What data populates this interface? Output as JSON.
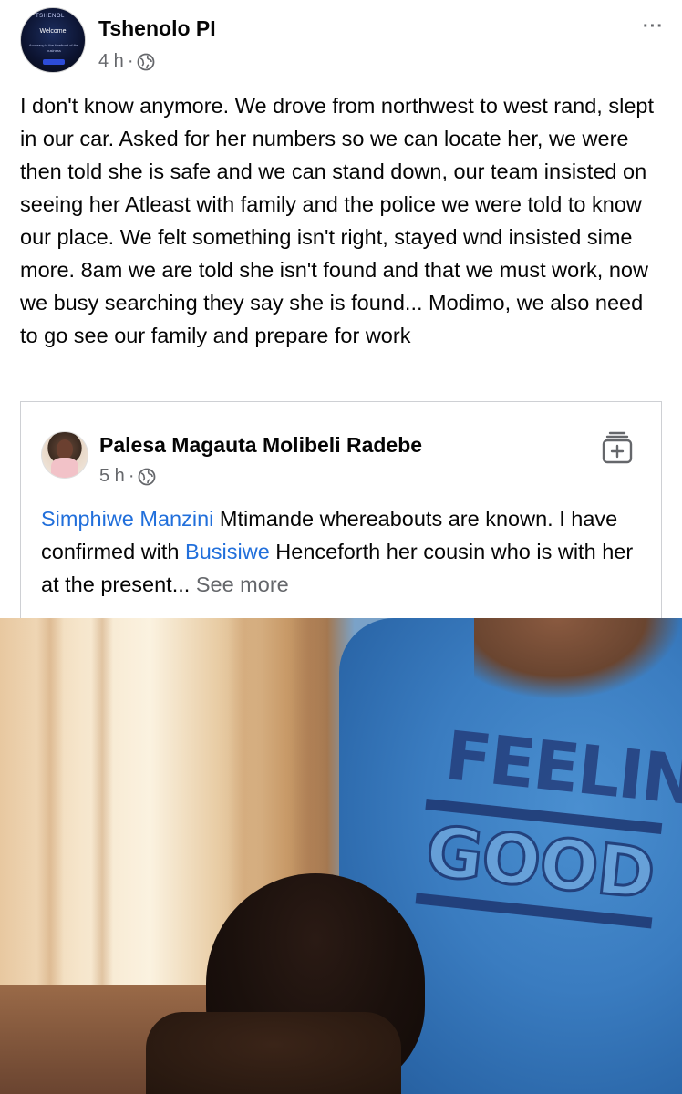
{
  "post": {
    "author": "Tshenolo PI",
    "time": "4 h",
    "separator": "·",
    "privacy_icon": "globe-icon",
    "more_icon": "···",
    "avatar_text": {
      "brand": "TSHENOL",
      "welcome": "Welcome",
      "tagline": "Accuracy is the forefront of the business"
    },
    "text": "I don't know anymore. We drove from northwest to west rand, slept in our car. Asked for her numbers so we can locate her, we were then told she is safe and we can stand down, our team insisted on seeing her Atleast with family and the police we were told to know our place. We felt something isn't right, stayed wnd insisted sime more. 8am we are told she isn't found and that we must work, now we busy searching they say she is found... Modimo, we also need to go see our family and prepare for work"
  },
  "shared": {
    "author": "Palesa Magauta Molibeli Radebe",
    "time": "5 h",
    "separator": "·",
    "privacy_icon": "globe-icon",
    "save_icon": "save-collection-icon",
    "mention_1": "Simphiwe Manzini",
    "text_1": " Mtimande whereabouts are known. I have confirmed with ",
    "mention_2": "Busisiwe",
    "text_2": " Henceforth her cousin who is with her at the present...",
    "see_more": " See more"
  },
  "photo": {
    "shirt_line_1": "FEELIN",
    "shirt_line_2": "GOOD"
  },
  "colors": {
    "link": "#216fdb",
    "meta": "#65676b",
    "text": "#050505",
    "border": "#ced0d4"
  }
}
